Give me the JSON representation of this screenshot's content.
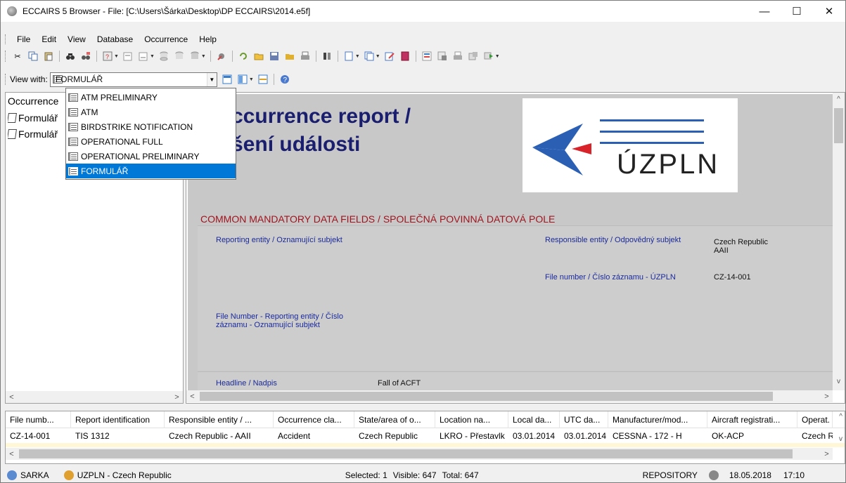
{
  "window": {
    "title": "ECCAIRS 5 Browser - File: [C:\\Users\\Šárka\\Desktop\\DP ECCAIRS\\2014.e5f]",
    "minimize": "—",
    "maximize": "☐",
    "close": "✕"
  },
  "menu": [
    "File",
    "Edit",
    "View",
    "Database",
    "Occurrence",
    "Help"
  ],
  "viewbar": {
    "label": "View with:",
    "selected": "FORMULÁŘ"
  },
  "dropdown": [
    "ATM PRELIMINARY",
    "ATM",
    "BIRDSTRIKE NOTIFICATION",
    "OPERATIONAL FULL",
    "OPERATIONAL PRELIMINARY",
    "FORMULÁŘ"
  ],
  "tree": {
    "root": "Occurrence",
    "items": [
      "Formulář",
      "Formulář"
    ]
  },
  "report": {
    "title_line1": "ccurrence report /",
    "title_line2": "šení události",
    "logo_text": "ÚZPLN",
    "section_title": "COMMON MANDATORY DATA FIELDS / SPOLEČNÁ POVINNÁ DATOVÁ POLE",
    "reporting_entity_label": "Reporting entity / Oznamující subjekt",
    "responsible_entity_label": "Responsible entity / Odpovědný subjekt",
    "responsible_entity_value1": "Czech Republic",
    "responsible_entity_value2": "AAII",
    "file_number_label": "File number / Číslo záznamu - ÚZPLN",
    "file_number_value": "CZ-14-001",
    "file_number_reporting_label1": "File Number -  Reporting entity / Číslo",
    "file_number_reporting_label2": "záznamu - Oznamující subjekt",
    "headline_label": "Headline / Nadpis",
    "headline_value": "Fall of ACFT"
  },
  "grid": {
    "columns": [
      "File numb...",
      "Report identification",
      "Responsible entity / ...",
      "Occurrence cla...",
      "State/area of o...",
      "Location na...",
      "Local da...",
      "UTC da...",
      "Manufacturer/mod...",
      "Aircraft registrati...",
      "Operat."
    ],
    "row": [
      "CZ-14-001",
      "TIS 1312",
      "Czech Republic - AAII",
      "Accident",
      "Czech Republic",
      "LKRO - Přestavlk",
      "03.01.2014",
      "03.01.2014",
      "CESSNA - 172 - H",
      "OK-ACP",
      "Czech R"
    ]
  },
  "status": {
    "user": "SARKA",
    "org": "UZPLN - Czech Republic",
    "selected": "Selected: 1",
    "visible": "Visible: 647",
    "total": "Total: 647",
    "mode": "REPOSITORY",
    "date": "18.05.2018",
    "time": "17:10"
  },
  "colors": {
    "selection": "#0078d7",
    "report_title": "#1a1e6e",
    "section_title": "#a0141e",
    "field_label": "#1a2a9a"
  }
}
